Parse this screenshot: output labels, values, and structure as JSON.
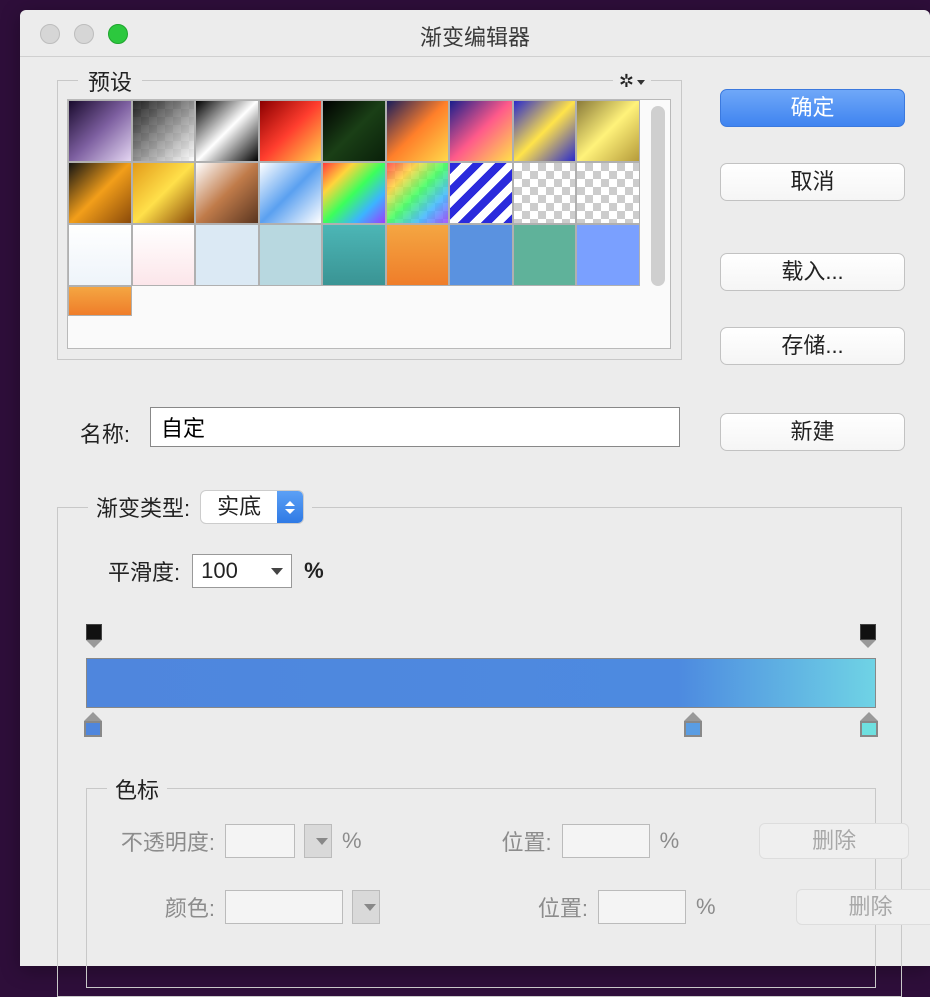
{
  "window_title": "渐变编辑器",
  "presets": {
    "legend": "预设",
    "gear_icon": "gear"
  },
  "buttons": {
    "ok": "确定",
    "cancel": "取消",
    "load": "载入...",
    "save": "存储...",
    "new": "新建"
  },
  "name": {
    "label": "名称:",
    "value": "自定"
  },
  "gradient": {
    "type_label": "渐变类型:",
    "type_value": "实底",
    "smoothness_label": "平滑度:",
    "smoothness_value": "100",
    "smoothness_unit": "%"
  },
  "stops_section": {
    "legend": "色标",
    "opacity_label": "不透明度:",
    "opacity_value": "",
    "opacity_unit": "%",
    "opacity_pos_label": "位置:",
    "opacity_pos_value": "",
    "opacity_pos_unit": "%",
    "color_label": "颜色:",
    "color_value": "",
    "color_pos_label": "位置:",
    "color_pos_value": "",
    "color_pos_unit": "%",
    "delete1": "删除",
    "delete2": "删除"
  },
  "swatches": [
    {
      "css": "linear-gradient(135deg,#1a0b2e,#7d5fa0,#e4d6f2)"
    },
    {
      "css": "linear-gradient(135deg,#000,#fff)",
      "checker": true
    },
    {
      "css": "linear-gradient(135deg,#000 0%,#fff 50%,#000 100%)"
    },
    {
      "css": "linear-gradient(135deg,#8b0000,#ff3d2e,#ffd34a)"
    },
    {
      "css": "linear-gradient(135deg,#000,#1a3f16,#0a200a)"
    },
    {
      "css": "linear-gradient(135deg,#1a1e5c,#ff7f2a,#ffd84a)"
    },
    {
      "css": "linear-gradient(135deg,#1a1e8c,#ff5a8a,#ffe04a)"
    },
    {
      "css": "linear-gradient(135deg,#2a2acc,#ffe34a,#2a2acc)"
    },
    {
      "css": "linear-gradient(135deg,#8a7a3a,#fff27a,#b59b3a)"
    },
    {
      "css": "linear-gradient(135deg,#141414,#f29e1a,#8a4a0a)"
    },
    {
      "css": "linear-gradient(135deg,#e39b1a,#ffe04a,#8a4a0a)"
    },
    {
      "css": "linear-gradient(135deg,#fff,#c07b4a,#5a3520)"
    },
    {
      "css": "linear-gradient(135deg,#fff,#5aa0f0,#fff)"
    },
    {
      "css": "linear-gradient(135deg,#ff3c3c,#ffd43c,#3cff5c,#3cb4ff,#9a3cff)"
    },
    {
      "css": "linear-gradient(135deg,#ff3c3c,#ffd43c,#3cff5c,#3cb4ff,#9a3cff)",
      "checker": true
    },
    {
      "css": "repeating-linear-gradient(135deg,#2a2adc 0 8px,#fff 8px 16px)"
    },
    {
      "css": "",
      "checker": true
    },
    {
      "css": "",
      "checker": true
    },
    {
      "css": "linear-gradient(#fff,#eef4fa)"
    },
    {
      "css": "linear-gradient(#fff,#fce6ea)"
    },
    {
      "css": "#dbe9f4"
    },
    {
      "css": "#b8d8e0"
    },
    {
      "css": "linear-gradient(#4cb6b6,#3a9494)"
    },
    {
      "css": "linear-gradient(#f4a642,#ef7d2a)"
    },
    {
      "css": "#5a92e0"
    },
    {
      "css": "#5fb29a"
    },
    {
      "css": "#7aa0ff"
    },
    {
      "css": "linear-gradient(#f4a642,#ef7d2a)",
      "last": true
    }
  ]
}
